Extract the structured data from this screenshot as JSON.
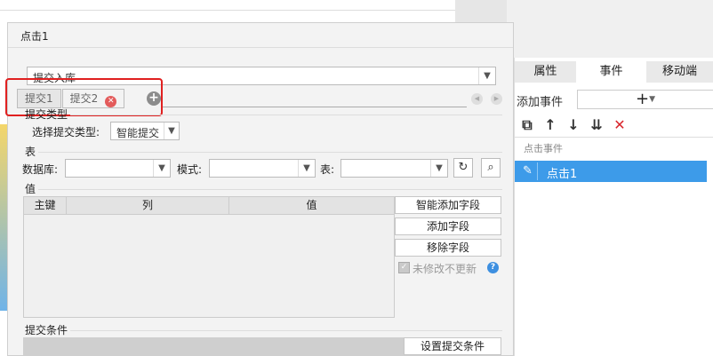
{
  "dialog": {
    "title": "点击1",
    "submit_action": "提交入库",
    "sub_tabs": [
      {
        "label": "提交1"
      },
      {
        "label": "提交2"
      }
    ],
    "submit_type": {
      "section_title": "提交类型",
      "label": "选择提交类型:",
      "value": "智能提交"
    },
    "table_section": {
      "title": "表",
      "database_label": "数据库:",
      "schema_label": "模式:",
      "table_label": "表:"
    },
    "value_section": {
      "title": "值",
      "columns": [
        "主键",
        "列",
        "值"
      ],
      "buttons": {
        "smart_add": "智能添加字段",
        "add": "添加字段",
        "remove": "移除字段"
      },
      "unchanged_checkbox": "未修改不更新"
    },
    "condition_section": {
      "title": "提交条件",
      "button": "设置提交条件"
    }
  },
  "right_panel": {
    "tabs": [
      {
        "label": "属性",
        "active": false
      },
      {
        "label": "事件",
        "active": true
      },
      {
        "label": "移动端",
        "active": false
      }
    ],
    "add_event_label": "添加事件",
    "add_event_button": "+",
    "section_title": "点击事件",
    "events": [
      {
        "label": "点击1",
        "selected": true
      }
    ]
  },
  "colors": {
    "accent": "#3d9be9",
    "highlight": "#e02020",
    "delete": "#d9262c"
  }
}
